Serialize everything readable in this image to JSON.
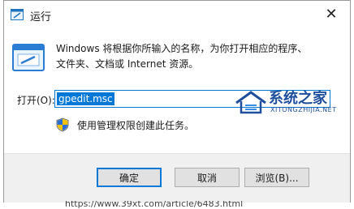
{
  "window": {
    "title": "运行",
    "close_glyph": "✕"
  },
  "description": {
    "line1": "Windows 将根据你所输入的名称，为你打开相应的程序、",
    "line2": "文件夹、文档或 Internet 资源。"
  },
  "open": {
    "label": "打开(O):",
    "value": "gpedit.msc"
  },
  "admin_note": "使用管理权限创建此任务。",
  "buttons": {
    "ok": "确定",
    "cancel": "取消",
    "browse": "浏览(B)..."
  },
  "watermark": {
    "title": "系统之家",
    "subtitle": "XITONGZHIJIA.NET"
  },
  "url_fragment": "https://www.39xt.com/article/6483.html",
  "colors": {
    "accent": "#0078d7",
    "watermark": "#1f4e9e"
  },
  "icons": {
    "title": "run-dialog-icon",
    "main": "run-dialog-icon",
    "shield": "uac-shield-icon",
    "close": "close-icon"
  }
}
